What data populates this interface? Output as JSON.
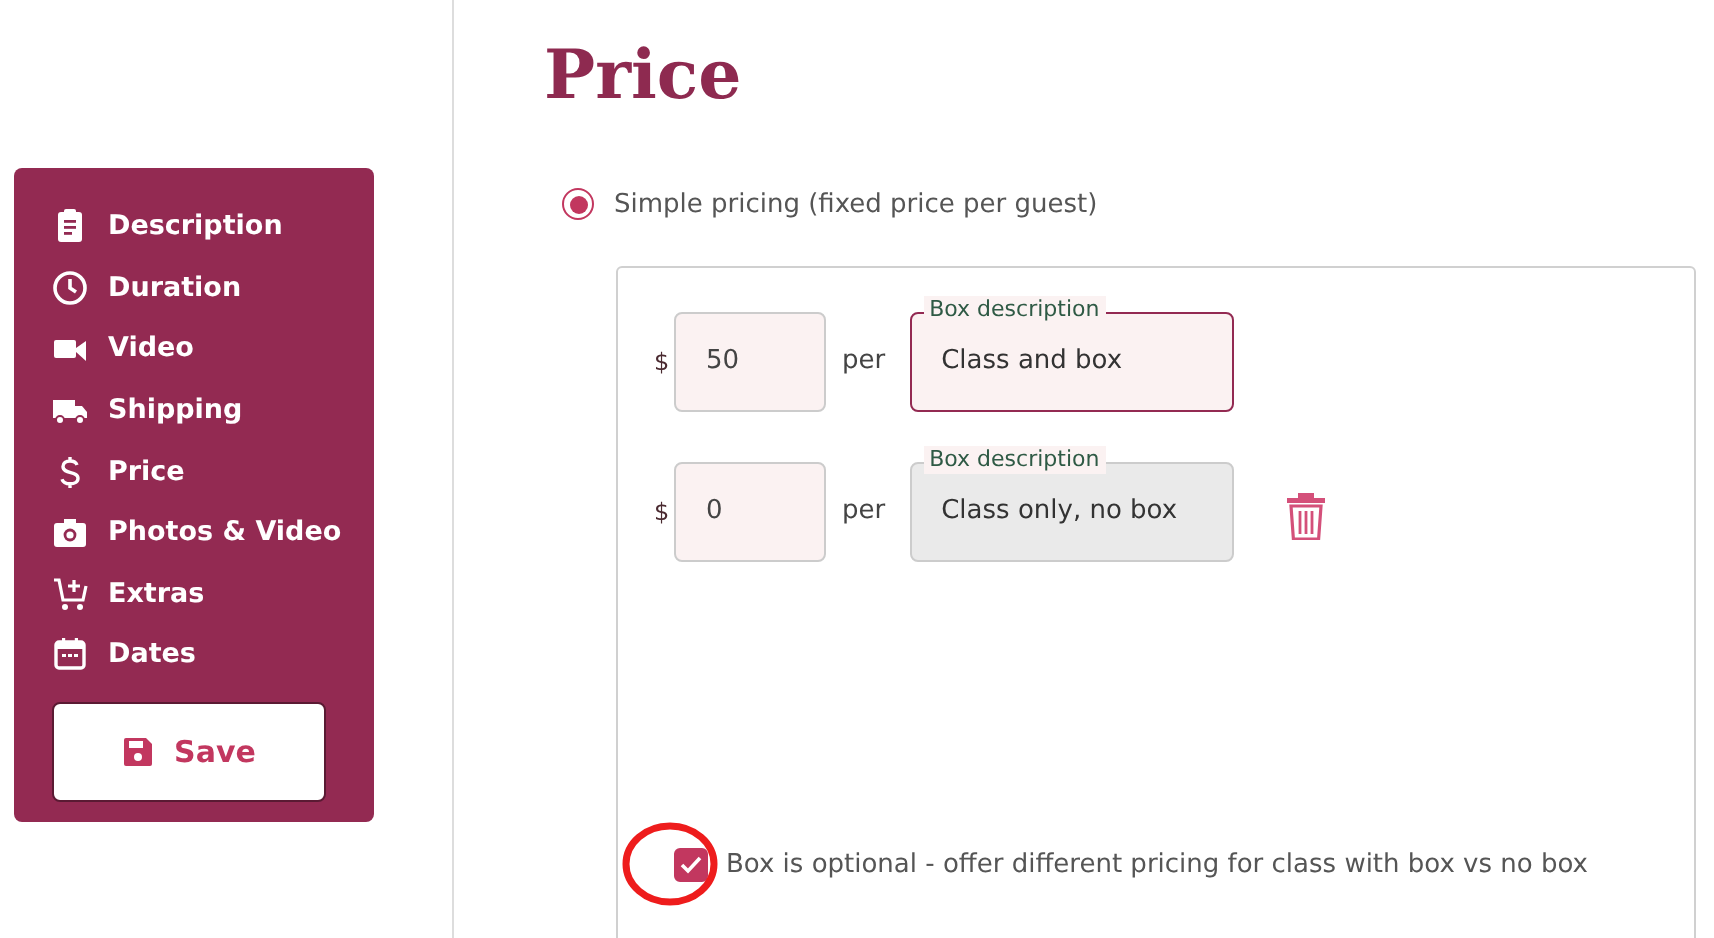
{
  "sidebar": {
    "items": [
      {
        "label": "Description"
      },
      {
        "label": "Duration"
      },
      {
        "label": "Video"
      },
      {
        "label": "Shipping"
      },
      {
        "label": "Price"
      },
      {
        "label": "Photos & Video"
      },
      {
        "label": "Extras"
      },
      {
        "label": "Dates"
      }
    ],
    "save_button": "Save"
  },
  "title": "Price",
  "pricing_option": {
    "label": "Simple pricing (fixed price per guest)",
    "selected": true
  },
  "price_rows": [
    {
      "currency": "$",
      "price": "50",
      "per": "per",
      "description_label": "Box description",
      "description": "Class and box",
      "focused": true,
      "disabled": false,
      "deletable": false
    },
    {
      "currency": "$",
      "price": "0",
      "per": "per",
      "description_label": "Box description",
      "description": "Class only, no box",
      "focused": false,
      "disabled": true,
      "deletable": true
    }
  ],
  "box_optional": {
    "label": "Box is optional - offer different pricing for class with box vs no box",
    "checked": true
  }
}
